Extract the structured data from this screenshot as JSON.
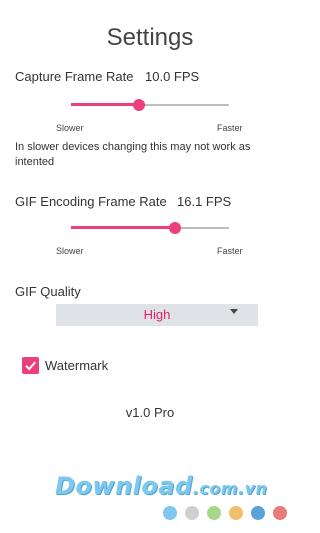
{
  "title": "Settings",
  "capture": {
    "label": "Capture Frame Rate",
    "value": "10.0 FPS",
    "slider_fraction": 0.43,
    "min_label": "Slower",
    "max_label": "Faster"
  },
  "note": "In slower devices changing this may not work as intented",
  "gif_rate": {
    "label": "GIF Encoding Frame Rate",
    "value": "16.1 FPS",
    "slider_fraction": 0.66,
    "min_label": "Slower",
    "max_label": "Faster"
  },
  "quality": {
    "label": "GIF Quality",
    "selected": "High"
  },
  "watermark_option": {
    "label": "Watermark",
    "checked": true
  },
  "version": "v1.0 Pro",
  "branding": {
    "text": "Download",
    "suffix": ".com.vn",
    "dot_colors": [
      "#7cc8f0",
      "#cfcfcf",
      "#a7d88a",
      "#f2c06b",
      "#5aa2d8",
      "#e97a7a"
    ]
  },
  "colors": {
    "accent": "#ec407a",
    "text": "#333333"
  }
}
